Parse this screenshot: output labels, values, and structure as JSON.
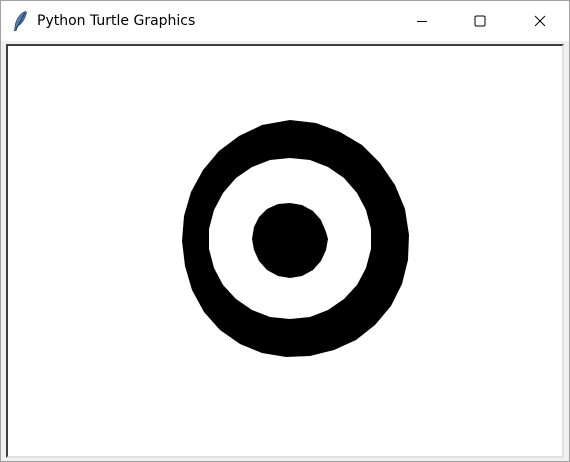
{
  "window": {
    "title": "Python Turtle Graphics",
    "app_icon": "feather-icon",
    "controls": {
      "minimize_icon": "minimize-icon",
      "maximize_icon": "maximize-icon",
      "close_icon": "close-icon"
    }
  },
  "canvas": {
    "background_color": "#ffffff",
    "drawing": {
      "description_shapes": [
        "outer-black-ring",
        "white-ring-gap",
        "center-black-dot"
      ],
      "ink_color": "#000000"
    }
  }
}
